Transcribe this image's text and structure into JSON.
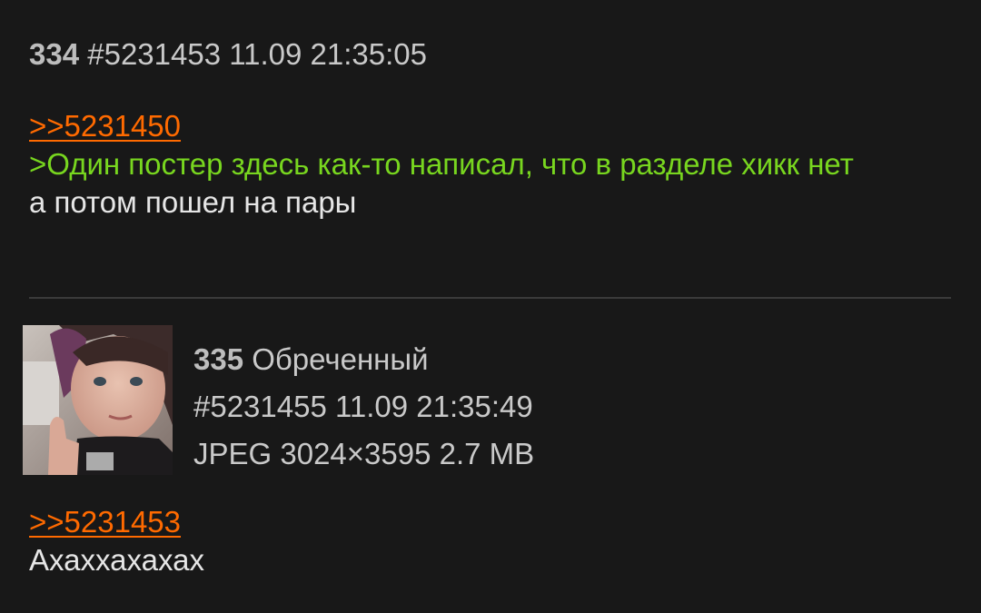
{
  "posts": [
    {
      "number": "334",
      "id": "#5231453",
      "datetime": "11.09 21:35:05",
      "reply_to": ">>5231450",
      "greentext": ">Один постер здесь как-то написал, что в разделе хикк нет",
      "text": "а потом пошел на пары"
    },
    {
      "number": "335",
      "name": "Обреченный",
      "id": "#5231455",
      "datetime": "11.09 21:35:49",
      "file_info": "JPEG 3024×3595 2.7 MB",
      "reply_to": ">>5231453",
      "text": "Ахаххахахах"
    }
  ],
  "colors": {
    "background": "#181818",
    "link": "#ff6a00",
    "greentext": "#78d61f",
    "text": "#e6e6e6",
    "meta": "#c9c9c9"
  }
}
